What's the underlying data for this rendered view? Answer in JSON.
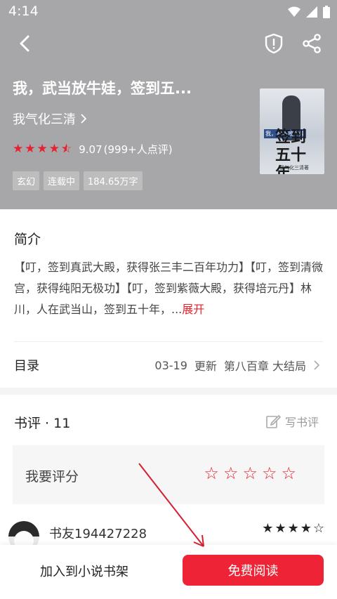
{
  "status_bar": {
    "time": "4:14"
  },
  "book": {
    "title": "我，武当放牛娃，签到五...",
    "author": "我气化三清",
    "rating": "9.07",
    "rating_count": "(999+人点评)",
    "tags": [
      "玄幻",
      "连载中",
      "184.65万字"
    ],
    "cover": {
      "tag": "我，武当放牛娃",
      "title": "签到五十年",
      "author": "我气化三清著"
    }
  },
  "intro": {
    "title": "简介",
    "text": "【叮，签到真武大殿，获得张三丰二百年功力】【叮，签到清微宫，获得纯阳无极功】【叮，签到紫薇大殿，获得培元丹】林川，人在武当山，签到五十年，...",
    "expand": "展开"
  },
  "toc": {
    "label": "目录",
    "date": "03-19",
    "update": "更新",
    "latest_chapter": "第八百章 大结局"
  },
  "reviews": {
    "title": "书评 · 11",
    "write_label": "写书评",
    "rate_label": "我要评分",
    "first_commenter": "书友194427228",
    "first_rating_stars": 4.5
  },
  "bottom": {
    "add_shelf": "加入到小说书架",
    "read": "免费阅读"
  },
  "colors": {
    "accent": "#ee2436",
    "header_bg": "#a7a7a9"
  }
}
